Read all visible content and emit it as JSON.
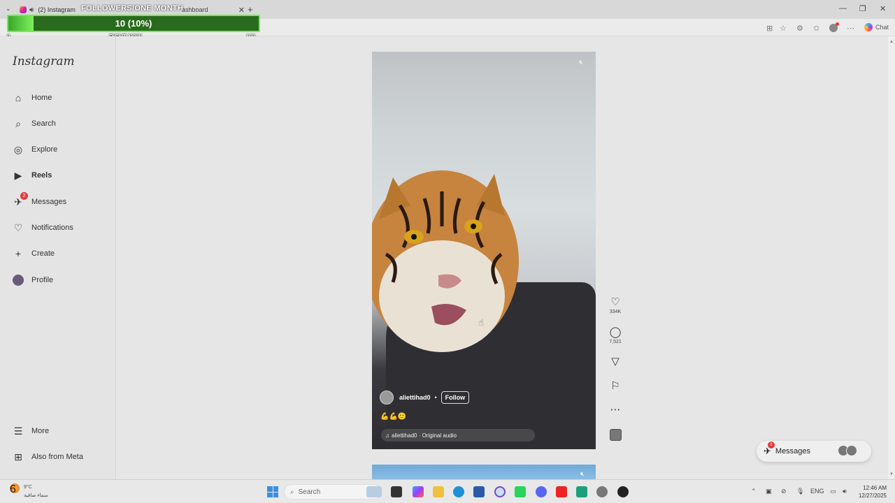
{
  "browser": {
    "tab1_title": "(2) Instagram",
    "tab2_title": "ashboard",
    "new_tab": "+",
    "chat_label": "Chat"
  },
  "overlay": {
    "title": "FOLLOWERS/ONE MONTH",
    "progress_text": "10 (10%)",
    "progress_fraction": 0.1,
    "label_min": "0",
    "label_mid": "RIGHT NOW",
    "label_max": "100"
  },
  "sidebar": {
    "logo": "Instagram",
    "items": [
      {
        "label": "Home",
        "icon": "home-icon"
      },
      {
        "label": "Search",
        "icon": "search-icon"
      },
      {
        "label": "Explore",
        "icon": "compass-icon"
      },
      {
        "label": "Reels",
        "icon": "reels-icon"
      },
      {
        "label": "Messages",
        "icon": "messenger-icon",
        "badge": "2"
      },
      {
        "label": "Notifications",
        "icon": "heart-icon"
      },
      {
        "label": "Create",
        "icon": "plus-icon"
      },
      {
        "label": "Profile",
        "icon": "profile-avatar"
      },
      {
        "label": "More",
        "icon": "hamburger-icon"
      },
      {
        "label": "Also from Meta",
        "icon": "meta-apps-icon"
      }
    ]
  },
  "reel": {
    "username": "aliettihad0",
    "separator": "•",
    "follow_label": "Follow",
    "caption": "💪💪🙂",
    "audio": "aliettihad0 · Original audio",
    "likes": "334K",
    "comments": "7,521"
  },
  "messages_pill": {
    "label": "Messages",
    "badge": "2"
  },
  "taskbar": {
    "weather_temp": "9°C",
    "weather_desc": "سماء صافية",
    "weather_badge": "6",
    "search_placeholder": "Search",
    "lang": "ENG",
    "time": "12:46 AM",
    "date": "12/27/2025"
  }
}
